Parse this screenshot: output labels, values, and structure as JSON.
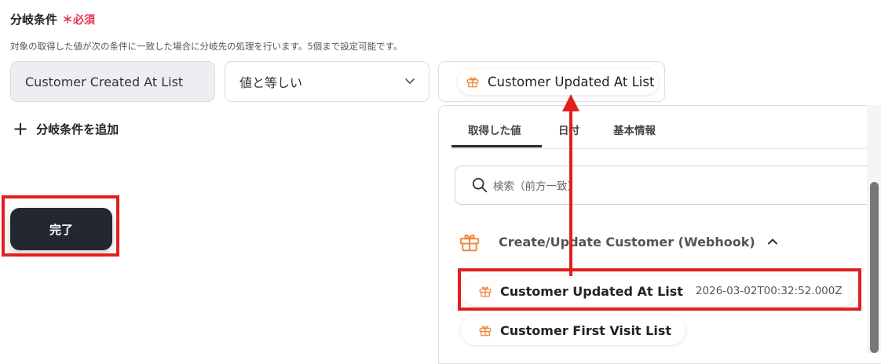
{
  "form": {
    "title": "分岐条件",
    "required_mark": "＊必須",
    "description": "対象の取得した値が次の条件に一致した場合に分岐先の処理を行います。5個まで設定可能です。",
    "condition": {
      "field": "Customer Created At List",
      "operator": "値と等しい",
      "value_chip": "Customer Updated At List"
    },
    "add_condition_label": "分岐条件を追加",
    "done_label": "完了"
  },
  "dropdown": {
    "tabs": [
      "取得した値",
      "日付",
      "基本情報"
    ],
    "active_tab": 0,
    "search_placeholder": "検索（前方一致）",
    "group": {
      "label": "Create/Update Customer (Webhook)",
      "expanded": true
    },
    "items": [
      {
        "name": "Customer Updated At List",
        "value": "2026-03-02T00:32:52.000Z",
        "highlighted": true
      },
      {
        "name": "Customer First Visit List",
        "value": ""
      }
    ]
  },
  "colors": {
    "accent_red": "#e0201f",
    "required_pink": "#e5334f",
    "icon_orange": "#f0883a",
    "button_dark": "#232830"
  },
  "icons": {
    "chip": "gift-icon",
    "search": "search-icon",
    "chevron": "chevron-down-icon",
    "caret": "chevron-up-icon"
  }
}
